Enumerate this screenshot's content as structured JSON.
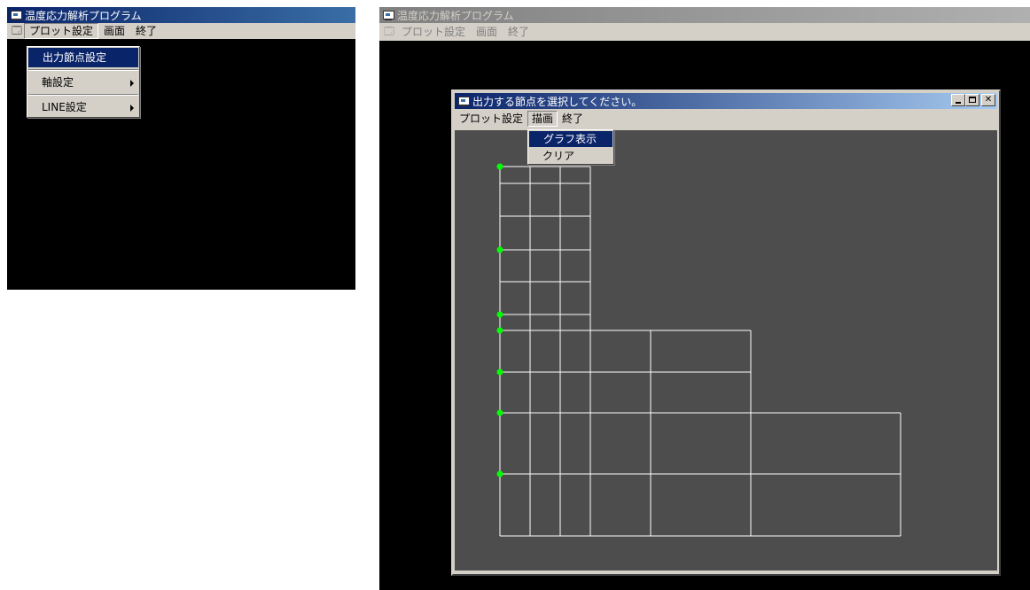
{
  "left_window": {
    "title": "温度応力解析プログラム",
    "menubar": [
      "プロット設定",
      "画面",
      "終了"
    ],
    "dropdown": [
      {
        "label": "出力節点設定",
        "submenu": false,
        "selected": true
      },
      {
        "label": "軸設定",
        "submenu": true,
        "selected": false
      },
      {
        "label": "LINE設定",
        "submenu": true,
        "selected": false
      }
    ]
  },
  "right_window": {
    "title": "温度応力解析プログラム",
    "menubar": [
      "プロット設定",
      "画面",
      "終了"
    ],
    "dialog": {
      "title": "出力する節点を選択してください。",
      "menubar": [
        "プロット設定",
        "描画",
        "終了"
      ],
      "active_menu": "描画",
      "dropdown": [
        {
          "label": "グラフ表示",
          "selected": true
        },
        {
          "label": "クリア",
          "selected": false
        }
      ],
      "window_controls": [
        "minimize",
        "maximize",
        "close"
      ]
    }
  },
  "colors": {
    "canvas_bg": "#4d4d4d",
    "mesh_line": "#ffffff",
    "selected_node": "#00ff00",
    "active_title": "#0a246a",
    "inactive_title": "#808080"
  },
  "mesh": {
    "x_columns": [
      0,
      1,
      2,
      3,
      4,
      5,
      6
    ],
    "selected_nodes_count": 7
  }
}
